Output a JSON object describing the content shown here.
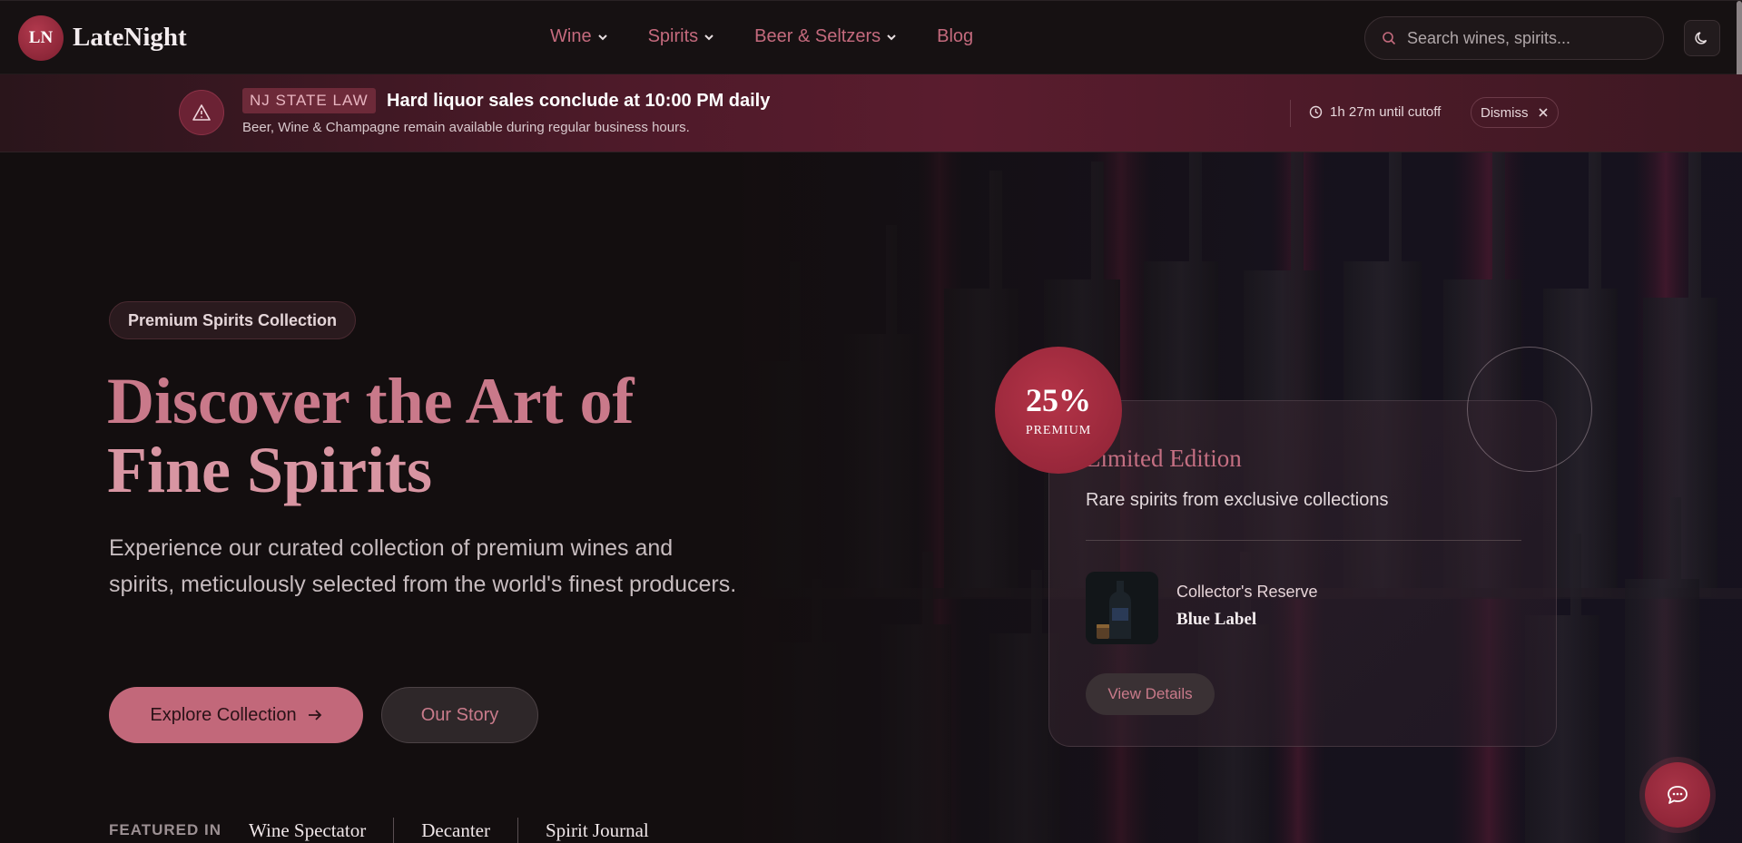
{
  "brand": {
    "initials": "LN",
    "name": "LateNight"
  },
  "nav": {
    "items": [
      {
        "label": "Wine",
        "dropdown": true
      },
      {
        "label": "Spirits",
        "dropdown": true
      },
      {
        "label": "Beer & Seltzers",
        "dropdown": true
      },
      {
        "label": "Blog",
        "dropdown": false
      }
    ],
    "search_placeholder": "Search wines, spirits..."
  },
  "alert": {
    "badge": "NJ STATE LAW",
    "title": "Hard liquor sales conclude at 10:00 PM daily",
    "subtitle": "Beer, Wine & Champagne remain available during regular business hours.",
    "countdown": "1h 27m until cutoff",
    "dismiss_label": "Dismiss"
  },
  "hero": {
    "pill": "Premium Spirits Collection",
    "headline_line1": "Discover the Art of",
    "headline_line2": "Fine Spirits",
    "description": "Experience our curated collection of premium wines and spirits, meticulously selected from the world's finest producers.",
    "primary_cta": "Explore Collection",
    "secondary_cta": "Our Story",
    "featured_label": "FEATURED IN",
    "featured_pubs": [
      "Wine Spectator",
      "Decanter",
      "Spirit Journal"
    ]
  },
  "promo_card": {
    "badge_percent": "25%",
    "badge_label": "PREMIUM",
    "title": "Limited Edition",
    "subtitle": "Rare spirits from exclusive collections",
    "product_label": "Collector's Reserve",
    "product_name": "Blue Label",
    "cta": "View Details"
  },
  "colors": {
    "accent": "#c2687a",
    "brand_red": "#8d2235",
    "background": "#141011"
  },
  "icons": {
    "search": "search-icon",
    "theme": "moon-icon",
    "alert": "warning-triangle-icon",
    "clock": "clock-icon",
    "close": "close-icon",
    "arrow": "arrow-right-icon",
    "chat": "chat-bubble-icon"
  }
}
